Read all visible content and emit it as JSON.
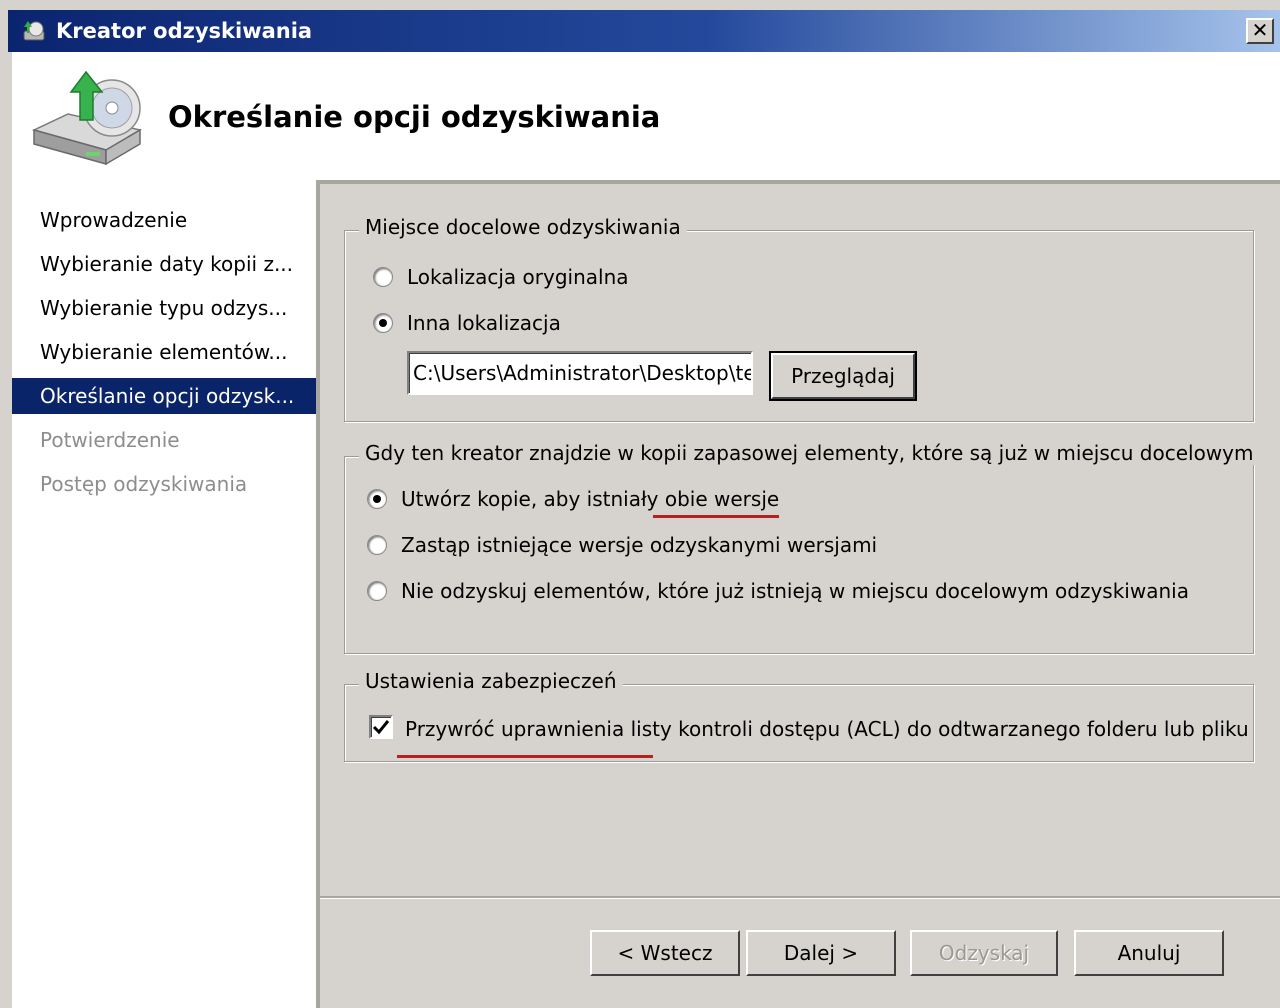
{
  "window": {
    "title": "Kreator odzyskiwania",
    "close_label": "✕"
  },
  "header": {
    "title": "Określanie opcji odzyskiwania",
    "icon": "backup-restore-drive-icon"
  },
  "sidebar": {
    "items": [
      {
        "label": "Wprowadzenie",
        "state": "normal"
      },
      {
        "label": "Wybieranie daty kopii z...",
        "state": "normal"
      },
      {
        "label": "Wybieranie typu odzys...",
        "state": "normal"
      },
      {
        "label": "Wybieranie elementów...",
        "state": "normal"
      },
      {
        "label": "Określanie opcji odzysk...",
        "state": "active"
      },
      {
        "label": "Potwierdzenie",
        "state": "disabled"
      },
      {
        "label": "Postęp odzyskiwania",
        "state": "disabled"
      }
    ]
  },
  "destination": {
    "legend": "Miejsce docelowe odzyskiwania",
    "option_original": "Lokalizacja oryginalna",
    "option_other": "Inna lokalizacja",
    "selected": "other",
    "path_value": "C:\\Users\\Administrator\\Desktop\\tes",
    "browse_label": "Przeglądaj"
  },
  "conflict": {
    "legend": "Gdy ten kreator znajdzie w kopii zapasowej elementy, które są już w miejscu docelowym",
    "option_copy": "Utwórz kopie, aby istniały obie wersje",
    "option_replace": "Zastąp istniejące wersje odzyskanymi wersjami",
    "option_skip": "Nie odzyskuj elementów, które już istnieją w miejscu docelowym odzyskiwania",
    "selected": "copy"
  },
  "security": {
    "legend": "Ustawienia zabezpieczeń",
    "acl_label": "Przywróć uprawnienia listy kontroli dostępu (ACL) do odtwarzanego folderu lub pliku",
    "acl_checked": true
  },
  "footer": {
    "back_label": "< Wstecz",
    "next_label": "Dalej >",
    "recover_label": "Odzyskaj",
    "cancel_label": "Anuluj"
  },
  "colors": {
    "title_bar": "#0b2470",
    "selection": "#0a246a",
    "annotation_red": "#b3221e",
    "dialog_bg": "#d6d3ce"
  }
}
